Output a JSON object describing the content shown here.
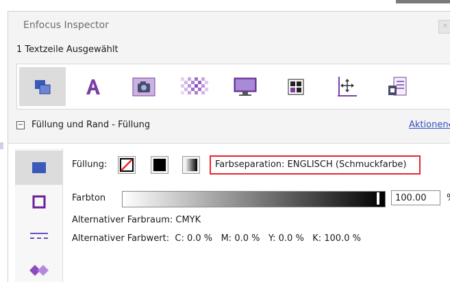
{
  "window": {
    "title": "Enfocus Inspector"
  },
  "selection_status": "1 Textzeile Ausgewählt",
  "toolbar": {
    "buttons": [
      {
        "icon": "object-arrange-icon",
        "active": true
      },
      {
        "icon": "text-icon",
        "active": false
      },
      {
        "icon": "camera-icon",
        "active": false
      },
      {
        "icon": "transparency-icon",
        "active": false
      },
      {
        "icon": "monitor-icon",
        "active": false
      },
      {
        "icon": "grid-icon",
        "active": false
      },
      {
        "icon": "position-axes-icon",
        "active": false
      },
      {
        "icon": "document-list-icon",
        "active": false
      }
    ]
  },
  "section": {
    "collapse_symbol": "−",
    "title": "Füllung und Rand - Füllung",
    "actions_label": "Aktionen",
    "actions_arrow": "▾"
  },
  "side_tabs": [
    {
      "icon": "fill-icon",
      "active": true
    },
    {
      "icon": "stroke-icon",
      "active": false
    },
    {
      "icon": "dashes-icon",
      "active": false
    },
    {
      "icon": "shapes-icon",
      "active": false
    }
  ],
  "fill": {
    "label": "Füllung:",
    "separation_text": "Farbseparation: ENGLISCH (Schmuckfarbe)",
    "tint_label": "Farbton",
    "tint_value": "100.00",
    "tint_unit": "%",
    "tint_level": 1.0,
    "alt_space_label": "Alternativer Farbraum:",
    "alt_space_value": "CMYK",
    "alt_value_label": "Alternativer Farbwert:",
    "cmyk": [
      {
        "key": "C:",
        "value": "0.0 %"
      },
      {
        "key": "M:",
        "value": "0.0 %"
      },
      {
        "key": "Y:",
        "value": "0.0 %"
      },
      {
        "key": "K:",
        "value": "100.0 %"
      }
    ]
  },
  "colors": {
    "accent_link": "#2e4fc0",
    "highlight_border": "#e8242b",
    "icon_purple": "#7b3fa6"
  }
}
